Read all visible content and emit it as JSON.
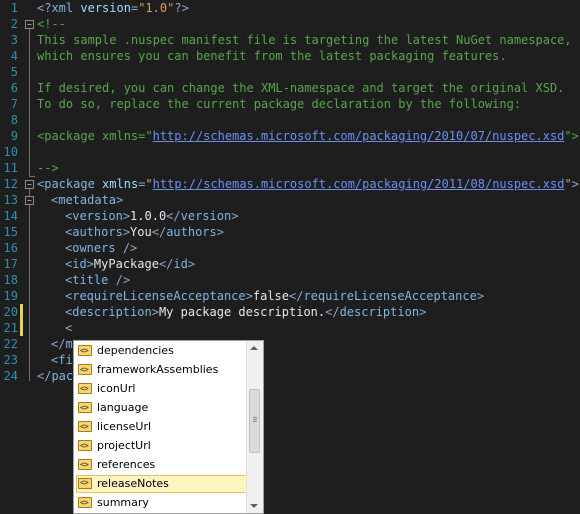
{
  "editor": {
    "lines": [
      {
        "n": "1",
        "code": "<?xml version=\"1.0\"?>"
      },
      {
        "n": "2",
        "code": "<!--"
      },
      {
        "n": "3",
        "code": "This sample .nuspec manifest file is targeting the latest NuGet namespace,"
      },
      {
        "n": "4",
        "code": "which ensures you can benefit from the latest packaging features."
      },
      {
        "n": "5",
        "code": ""
      },
      {
        "n": "6",
        "code": "If desired, you can change the XML-namespace and target the original XSD."
      },
      {
        "n": "7",
        "code": "To do so, replace the current package declaration by the following:"
      },
      {
        "n": "8",
        "code": ""
      },
      {
        "n": "9",
        "code": "<package xmlns=\"http://schemas.microsoft.com/packaging/2010/07/nuspec.xsd\">"
      },
      {
        "n": "10",
        "code": ""
      },
      {
        "n": "11",
        "code": "-->"
      },
      {
        "n": "12",
        "code": "<package xmlns=\"http://schemas.microsoft.com/packaging/2011/08/nuspec.xsd\">"
      },
      {
        "n": "13",
        "code": "<metadata>"
      },
      {
        "n": "14",
        "code": "<version>1.0.0</version>"
      },
      {
        "n": "15",
        "code": "<authors>You</authors>"
      },
      {
        "n": "16",
        "code": "<owners />"
      },
      {
        "n": "17",
        "code": "<id>MyPackage</id>"
      },
      {
        "n": "18",
        "code": "<title />"
      },
      {
        "n": "19",
        "code": "<requireLicenseAcceptance>false</requireLicenseAcceptance>"
      },
      {
        "n": "20",
        "code": "<description>My package description.</description>"
      },
      {
        "n": "21",
        "code": "<"
      },
      {
        "n": "22",
        "code": "</m"
      },
      {
        "n": "23",
        "code": "<fi"
      },
      {
        "n": "24",
        "code": "</pac"
      }
    ]
  },
  "completion": {
    "items": [
      "dependencies",
      "frameworkAssemblies",
      "iconUrl",
      "language",
      "licenseUrl",
      "projectUrl",
      "references",
      "releaseNotes",
      "summary"
    ],
    "selected": "releaseNotes",
    "icon": "xml-element-icon"
  },
  "colors": {
    "background": "#1e1e1e",
    "line_numbers": "#2b91af",
    "comment": "#57a64a",
    "tag": "#7fb4e6",
    "attribute_value": "#d7a25c",
    "link": "#6d8ff2",
    "modified_marker": "#e4d54c"
  }
}
